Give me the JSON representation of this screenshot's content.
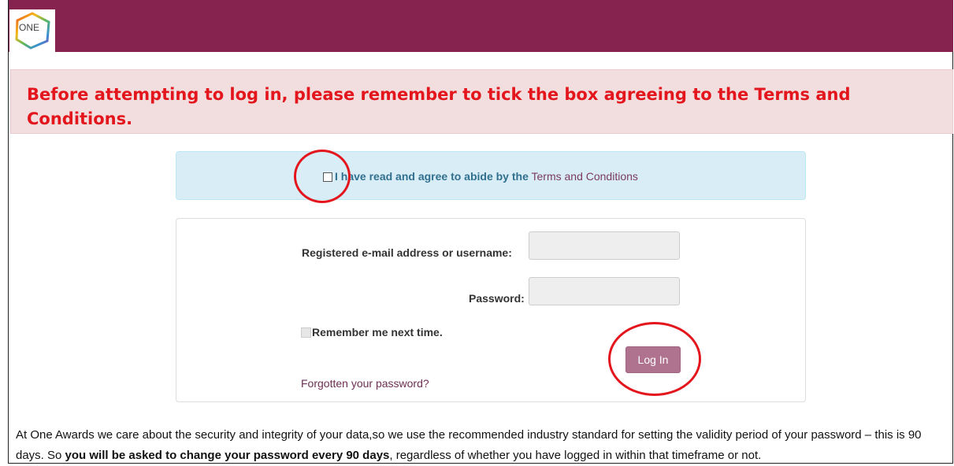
{
  "brand": {
    "logo_text": "ONE",
    "header_color": "#86244f"
  },
  "alert": {
    "message": "Before attempting to log in, please remember to tick the box agreeing to the Terms and Conditions.",
    "color": "#e2161c"
  },
  "terms": {
    "label": "I have read and agree to abide by the",
    "link_text": "Terms and Conditions",
    "checked": false
  },
  "login": {
    "username_label": "Registered e-mail address or username:",
    "username_value": "",
    "password_label": "Password:",
    "password_value": "",
    "remember_label": "Remember me next time.",
    "remember_checked": false,
    "login_button": "Log In",
    "forgot_link": "Forgotten your password?"
  },
  "info": {
    "part1": "At One Awards we care about the security and integrity of your data,so we use the recommended industry standard for setting the validity period of your password – this is 90 days.  So ",
    "bold": "you will be asked to change your password every 90 days",
    "part2": ", regardless of whether you have logged in within that timeframe or not."
  }
}
